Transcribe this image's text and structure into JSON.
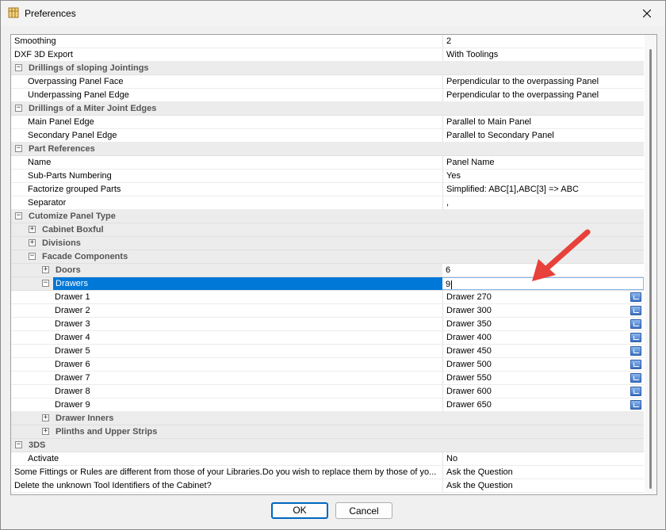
{
  "window": {
    "title": "Preferences"
  },
  "icons": {
    "app": "building-blocks-icon",
    "close": "close-icon",
    "expand": "plus-box-icon",
    "collapse": "minus-box-icon",
    "picker": "picker-button-icon"
  },
  "colors": {
    "selection": "#0078d7",
    "category_bg": "#ececec",
    "annotation_arrow": "#e8403a"
  },
  "rows": [
    {
      "name": "Smoothing",
      "value": "2"
    },
    {
      "name": "DXF 3D Export",
      "value": "With Toolings"
    },
    {
      "name": "Drillings of sloping Jointings",
      "value": ""
    },
    {
      "name": "Overpassing Panel Face",
      "value": "Perpendicular to the overpassing Panel"
    },
    {
      "name": "Underpassing Panel Edge",
      "value": "Perpendicular to the overpassing Panel"
    },
    {
      "name": "Drillings of a Miter Joint Edges",
      "value": ""
    },
    {
      "name": "Main Panel Edge",
      "value": "Parallel to Main Panel"
    },
    {
      "name": "Secondary Panel Edge",
      "value": "Parallel to Secondary Panel"
    },
    {
      "name": "Part References",
      "value": ""
    },
    {
      "name": "Name",
      "value": "Panel Name"
    },
    {
      "name": "Sub-Parts Numbering",
      "value": "Yes"
    },
    {
      "name": "Factorize grouped Parts",
      "value": "Simplified: ABC[1],ABC[3] => ABC"
    },
    {
      "name": "Separator",
      "value": ","
    },
    {
      "name": "Cutomize Panel Type",
      "value": ""
    },
    {
      "name": "Cabinet Boxful",
      "value": ""
    },
    {
      "name": "Divisions",
      "value": ""
    },
    {
      "name": "Facade Components",
      "value": ""
    },
    {
      "name": "Doors",
      "value": "6"
    },
    {
      "name": "Drawers",
      "value": "9"
    },
    {
      "name": "Drawer 1",
      "value": "Drawer 270"
    },
    {
      "name": "Drawer 2",
      "value": "Drawer 300"
    },
    {
      "name": "Drawer 3",
      "value": "Drawer 350"
    },
    {
      "name": "Drawer 4",
      "value": "Drawer 400"
    },
    {
      "name": "Drawer 5",
      "value": "Drawer 450"
    },
    {
      "name": "Drawer 6",
      "value": "Drawer 500"
    },
    {
      "name": "Drawer 7",
      "value": "Drawer 550"
    },
    {
      "name": "Drawer 8",
      "value": "Drawer 600"
    },
    {
      "name": "Drawer 9",
      "value": "Drawer 650"
    },
    {
      "name": "Drawer Inners",
      "value": ""
    },
    {
      "name": "Plinths and Upper Strips",
      "value": ""
    },
    {
      "name": "3DS",
      "value": ""
    },
    {
      "name": "Activate",
      "value": "No"
    },
    {
      "name": "Some Fittings or Rules are different from those of your Libraries.Do you wish to replace them by those of yo...",
      "value": "Ask the Question"
    },
    {
      "name": "Delete the unknown Tool Identifiers of the Cabinet?",
      "value": "Ask the Question"
    }
  ],
  "buttons": {
    "ok": "OK",
    "cancel": "Cancel"
  }
}
